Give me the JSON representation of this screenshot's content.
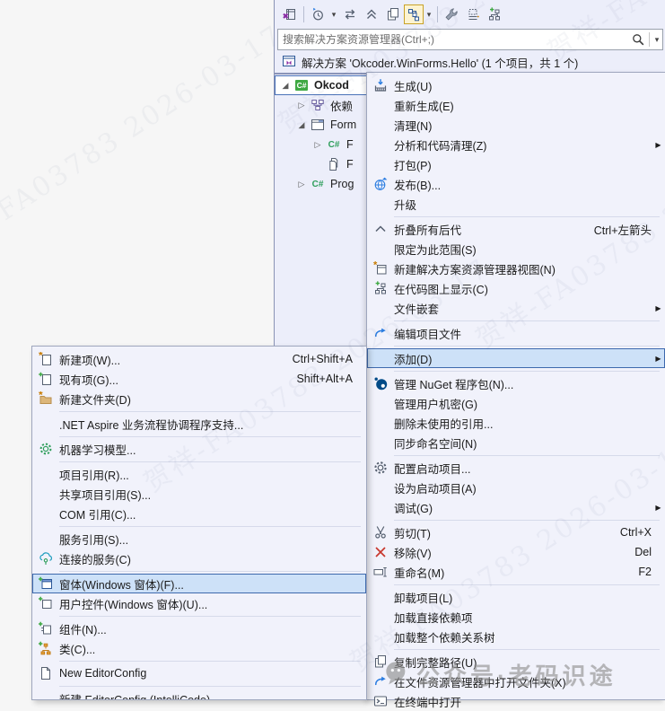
{
  "explorer": {
    "toolbar": {
      "items": [
        {
          "type": "icon",
          "name": "vs-window-icon"
        },
        {
          "type": "sep"
        },
        {
          "type": "icon",
          "name": "history-clock-icon"
        },
        {
          "type": "caret",
          "name": "caret-down-icon"
        },
        {
          "type": "icon",
          "name": "swap-arrows-icon"
        },
        {
          "type": "icon",
          "name": "collapse-all-icon"
        },
        {
          "type": "icon",
          "name": "copy-preview-icon"
        },
        {
          "type": "boxed",
          "name": "sync-active-document-icon"
        },
        {
          "type": "caret",
          "name": "caret-down-icon"
        },
        {
          "type": "sep"
        },
        {
          "type": "icon",
          "name": "wrench-icon"
        },
        {
          "type": "icon",
          "name": "show-all-files-icon"
        },
        {
          "type": "icon",
          "name": "add-node-icon"
        }
      ]
    },
    "search": {
      "placeholder": "搜索解决方案资源管理器(Ctrl+;)",
      "icon": "search-icon",
      "caret": "caret-down-icon"
    },
    "solution": {
      "icon": "solution-icon",
      "label": "解决方案 'Okcoder.WinForms.Hello' (1 个项目，共 1 个)"
    },
    "tree": [
      {
        "indent": 0,
        "expander": "expanded",
        "icon": "csharp-project-icon",
        "label": "Okcod",
        "selected": true
      },
      {
        "indent": 1,
        "expander": "collapsed",
        "icon": "dependencies-icon",
        "label": "依赖"
      },
      {
        "indent": 1,
        "expander": "expanded",
        "icon": "form-icon",
        "label": "Form"
      },
      {
        "indent": 2,
        "expander": "collapsed",
        "icon": "csharp-file-icon",
        "label": "F"
      },
      {
        "indent": 2,
        "expander": "none",
        "icon": "file-icon",
        "label": "F"
      },
      {
        "indent": 1,
        "expander": "collapsed",
        "icon": "csharp-file-icon",
        "label": "Prog"
      }
    ]
  },
  "context_menu": {
    "items": [
      {
        "icon": "build-icon",
        "label": "生成(U)"
      },
      {
        "label": "重新生成(E)"
      },
      {
        "label": "清理(N)"
      },
      {
        "label": "分析和代码清理(Z)",
        "arrow": true
      },
      {
        "label": "打包(P)"
      },
      {
        "icon": "publish-icon",
        "label": "发布(B)..."
      },
      {
        "label": "升级"
      },
      {
        "type": "separator"
      },
      {
        "icon": "collapse-chevron-icon",
        "label": "折叠所有后代",
        "shortcut": "Ctrl+左箭头"
      },
      {
        "label": "限定为此范围(S)"
      },
      {
        "icon": "new-view-icon",
        "label": "新建解决方案资源管理器视图(N)"
      },
      {
        "icon": "code-map-icon",
        "label": "在代码图上显示(C)"
      },
      {
        "label": "文件嵌套",
        "arrow": true
      },
      {
        "type": "separator"
      },
      {
        "icon": "edit-file-icon",
        "label": "编辑项目文件"
      },
      {
        "type": "separator"
      },
      {
        "label": "添加(D)",
        "arrow": true,
        "highlighted": true
      },
      {
        "type": "separator"
      },
      {
        "icon": "nuget-icon",
        "label": "管理 NuGet 程序包(N)..."
      },
      {
        "label": "管理用户机密(G)"
      },
      {
        "label": "删除未使用的引用..."
      },
      {
        "label": "同步命名空间(N)"
      },
      {
        "type": "separator"
      },
      {
        "icon": "gear-icon",
        "label": "配置启动项目..."
      },
      {
        "label": "设为启动项目(A)"
      },
      {
        "label": "调试(G)",
        "arrow": true
      },
      {
        "type": "separator"
      },
      {
        "icon": "cut-icon",
        "label": "剪切(T)",
        "shortcut": "Ctrl+X"
      },
      {
        "icon": "remove-icon",
        "label": "移除(V)",
        "shortcut": "Del"
      },
      {
        "icon": "rename-icon",
        "label": "重命名(M)",
        "shortcut": "F2"
      },
      {
        "type": "separator"
      },
      {
        "label": "卸载项目(L)"
      },
      {
        "label": "加载直接依赖项"
      },
      {
        "label": "加载整个依赖关系树"
      },
      {
        "type": "separator"
      },
      {
        "icon": "copy-path-icon",
        "label": "复制完整路径(U)"
      },
      {
        "icon": "open-folder-icon",
        "label": "在文件资源管理器中打开文件夹(X)"
      },
      {
        "icon": "terminal-icon",
        "label": "在终端中打开"
      }
    ]
  },
  "add_submenu": {
    "items": [
      {
        "icon": "new-item-icon",
        "label": "新建项(W)...",
        "shortcut": "Ctrl+Shift+A"
      },
      {
        "icon": "existing-item-icon",
        "label": "现有项(G)...",
        "shortcut": "Shift+Alt+A"
      },
      {
        "icon": "new-folder-icon",
        "label": "新建文件夹(D)"
      },
      {
        "type": "separator"
      },
      {
        "label": ".NET Aspire 业务流程协调程序支持..."
      },
      {
        "type": "separator"
      },
      {
        "icon": "ml-model-icon",
        "label": "机器学习模型..."
      },
      {
        "type": "separator"
      },
      {
        "label": "项目引用(R)..."
      },
      {
        "label": "共享项目引用(S)..."
      },
      {
        "label": "COM 引用(C)..."
      },
      {
        "type": "separator"
      },
      {
        "label": "服务引用(S)..."
      },
      {
        "icon": "connected-service-icon",
        "label": "连接的服务(C)"
      },
      {
        "type": "separator"
      },
      {
        "icon": "winform-icon",
        "label": "窗体(Windows 窗体)(F)...",
        "highlighted": true
      },
      {
        "icon": "user-control-icon",
        "label": "用户控件(Windows 窗体)(U)..."
      },
      {
        "type": "separator"
      },
      {
        "icon": "component-icon",
        "label": "组件(N)..."
      },
      {
        "icon": "class-icon",
        "label": "类(C)..."
      },
      {
        "type": "separator"
      },
      {
        "icon": "doc-icon",
        "label": "New EditorConfig"
      },
      {
        "type": "separator"
      },
      {
        "label": "新建 EditorConfig (IntelliCode)"
      }
    ]
  },
  "watermarks": {
    "stamp": "贺祥-FA03783  2026-03-17",
    "footer": "公众号·老码识途"
  },
  "colors": {
    "menu_bg": "#f1f2fb",
    "menu_border": "#9ea6bd",
    "highlight_bg": "#cde1f8",
    "highlight_border": "#3e69ad",
    "panel_bg": "#eceefa",
    "accent_green": "#3fa943",
    "accent_blue": "#2b7de1",
    "nuget_blue": "#004a87",
    "remove_red": "#c8372d"
  }
}
